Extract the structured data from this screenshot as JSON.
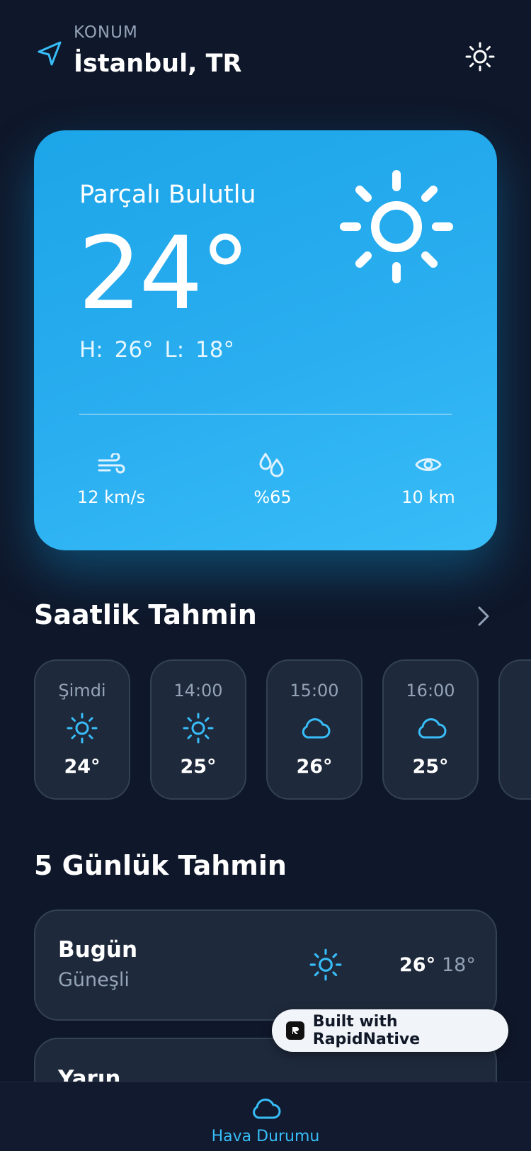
{
  "header": {
    "label": "KONUM",
    "city": "İstanbul, TR"
  },
  "hero": {
    "condition": "Parçalı Bulutlu",
    "temperature": "24°",
    "high": "H: 26°",
    "low": "L: 18°",
    "stats": [
      {
        "icon": "wind-icon",
        "value": "12 km/s"
      },
      {
        "icon": "humidity-icon",
        "value": "%65"
      },
      {
        "icon": "eye-icon",
        "value": "10 km"
      }
    ]
  },
  "hourly": {
    "title": "Saatlik Tahmin",
    "items": [
      {
        "time": "Şimdi",
        "icon": "sun-icon",
        "temp": "24°"
      },
      {
        "time": "14:00",
        "icon": "sun-icon",
        "temp": "25°"
      },
      {
        "time": "15:00",
        "icon": "cloud-icon",
        "temp": "26°"
      },
      {
        "time": "16:00",
        "icon": "cloud-icon",
        "temp": "25°"
      }
    ]
  },
  "daily": {
    "title": "5 Günlük Tahmin",
    "items": [
      {
        "day": "Bugün",
        "condition": "Güneşli",
        "icon": "sun-icon",
        "high": "26°",
        "low": "18°"
      },
      {
        "day": "Yarın"
      }
    ]
  },
  "badge": {
    "label": "Built with RapidNative"
  },
  "nav": {
    "label": "Hava Durumu"
  },
  "colors": {
    "background": "#0f172a",
    "card": "#1e293b",
    "accent": "#38bdf8",
    "hero": "#2aaef0"
  }
}
